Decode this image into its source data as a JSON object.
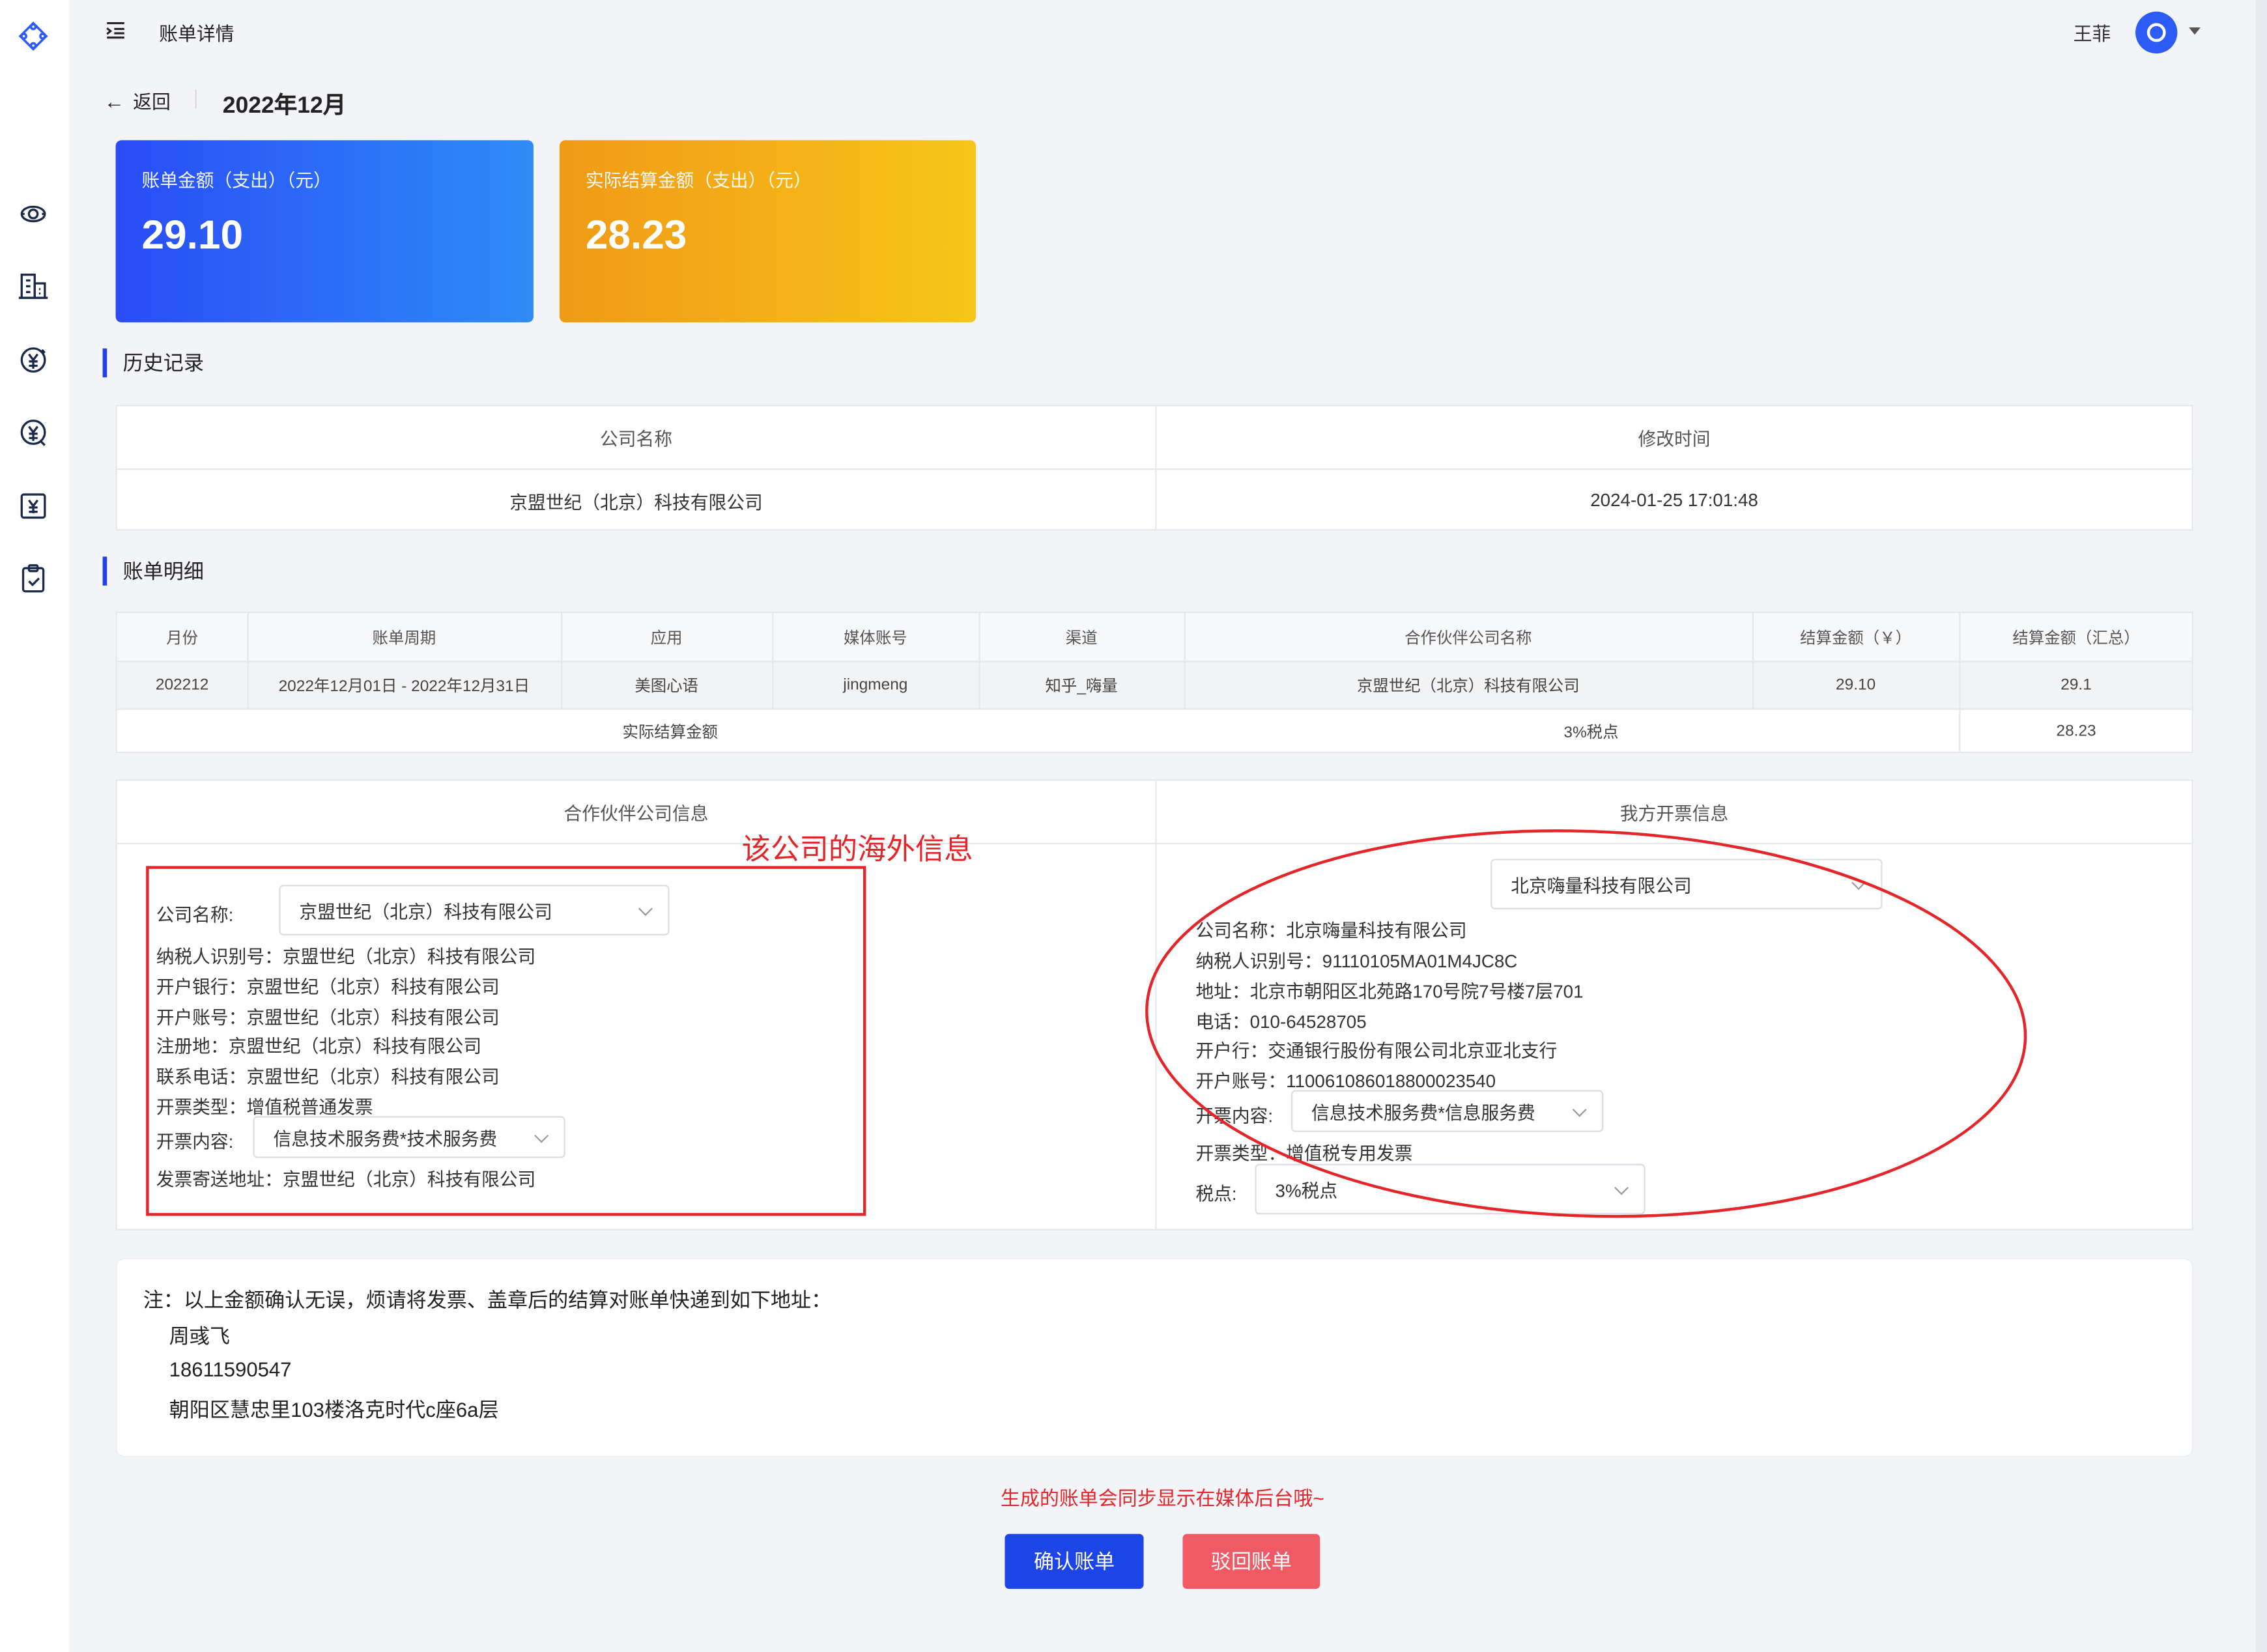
{
  "header": {
    "title": "账单详情",
    "user_name": "王菲"
  },
  "nav": {
    "back_label": "返回",
    "period": "2022年12月"
  },
  "cards": [
    {
      "label": "账单金额（支出）（元）",
      "value": "29.10"
    },
    {
      "label": "实际结算金额（支出）（元）",
      "value": "28.23"
    }
  ],
  "history": {
    "title": "历史记录",
    "columns": [
      "公司名称",
      "修改时间"
    ],
    "rows": [
      [
        "京盟世纪（北京）科技有限公司",
        "2024-01-25 17:01:48"
      ]
    ]
  },
  "bill_detail": {
    "title": "账单明细",
    "columns": [
      "月份",
      "账单周期",
      "应用",
      "媒体账号",
      "渠道",
      "合作伙伴公司名称",
      "结算金额（￥）",
      "结算金额（汇总）"
    ],
    "rows": [
      [
        "202212",
        "2022年12月01日 - 2022年12月31日",
        "美图心语",
        "jingmeng",
        "知乎_嗨量",
        "京盟世纪（北京）科技有限公司",
        "29.10",
        "29.1"
      ]
    ],
    "summary": {
      "label": "实际结算金额",
      "tax": "3%税点",
      "value": "28.23"
    }
  },
  "partner_info": {
    "title": "合作伙伴公司信息",
    "company_label": "公司名称:",
    "company_select": "京盟世纪（北京）科技有限公司",
    "lines": [
      "纳税人识别号：京盟世纪（北京）科技有限公司",
      "开户银行：京盟世纪（北京）科技有限公司",
      "开户账号：京盟世纪（北京）科技有限公司",
      "注册地：京盟世纪（北京）科技有限公司",
      "联系电话：京盟世纪（北京）科技有限公司",
      "开票类型：增值税普通发票"
    ],
    "invoice_content_label": "开票内容:",
    "invoice_content_select": "信息技术服务费*技术服务费",
    "address_line": "发票寄送地址：京盟世纪（北京）科技有限公司"
  },
  "our_info": {
    "title": "我方开票信息",
    "company_select": "北京嗨量科技有限公司",
    "lines": [
      "公司名称：北京嗨量科技有限公司",
      "纳税人识别号：91110105MA01M4JC8C",
      "地址：北京市朝阳区北苑路170号院7号楼7层701",
      "电话：010-64528705",
      "开户行：交通银行股份有限公司北京亚北支行",
      "开户账号：110061086018800023540"
    ],
    "invoice_content_label": "开票内容:",
    "invoice_content_select": "信息技术服务费*信息服务费",
    "invoice_type_line": "开票类型：增值税专用发票",
    "tax_label": "税点:",
    "tax_select": "3%税点"
  },
  "annotation": {
    "label": "该公司的海外信息",
    "color": "#e4262b"
  },
  "note": {
    "line1": "注：以上金额确认无误，烦请将发票、盖章后的结算对账单快递到如下地址：",
    "name": "周彧飞",
    "phone": "18611590547",
    "address": "朝阳区慧忠里103楼洛克时代c座6a层"
  },
  "footer": {
    "sync_notice": "生成的账单会同步显示在媒体后台哦~",
    "confirm_label": "确认账单",
    "reject_label": "驳回账单"
  },
  "colors": {
    "primary": "#1d44e6",
    "danger_button": "#ef5a64",
    "card_blue": "#2a4cf7",
    "card_orange": "#f09a16"
  }
}
